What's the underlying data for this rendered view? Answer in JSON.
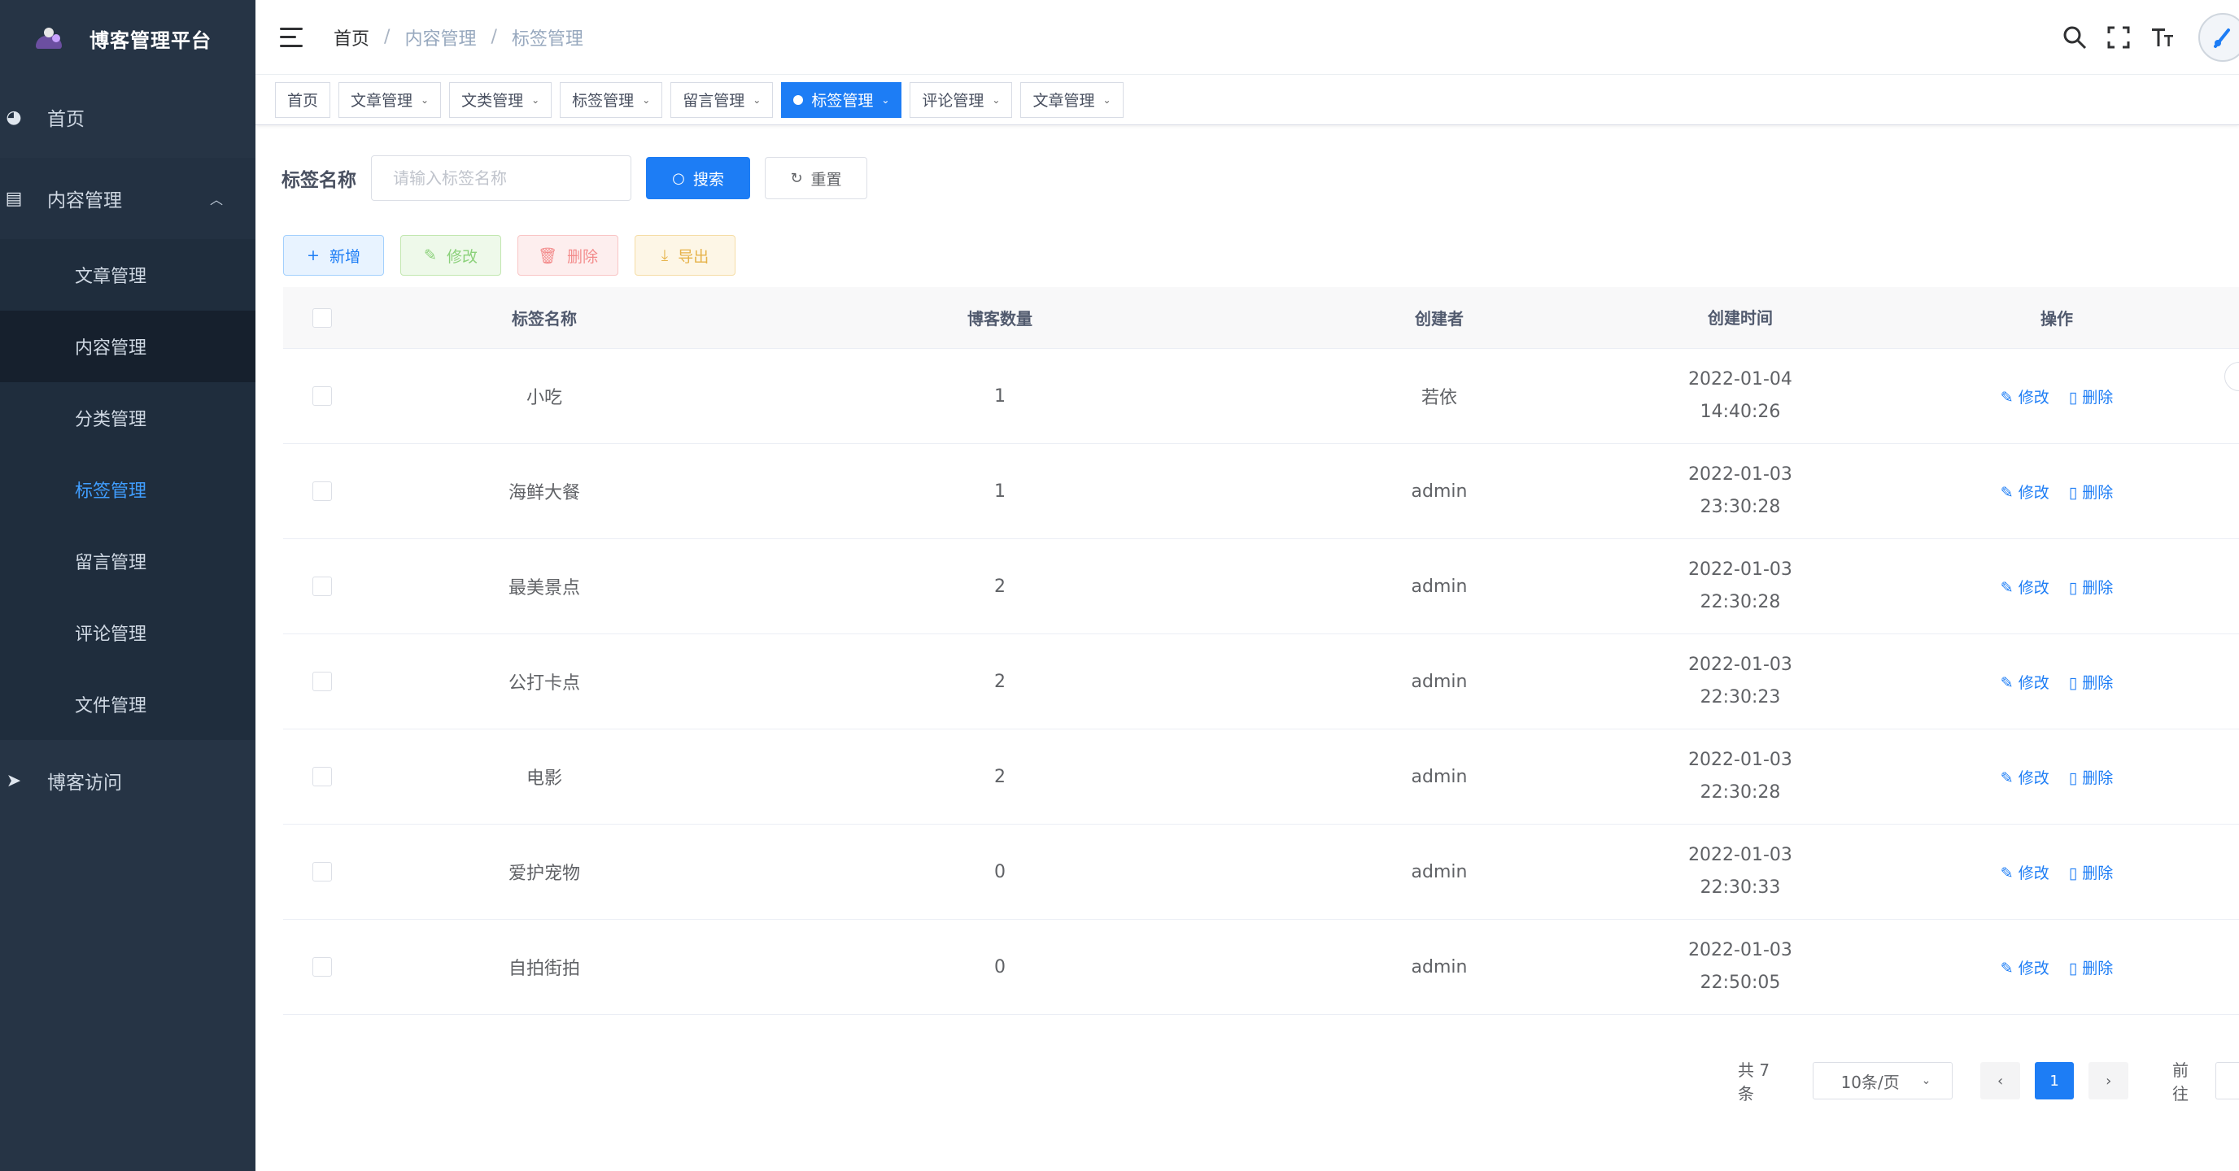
{
  "app": {
    "title": "博客管理平台"
  },
  "sidebar": {
    "home": "首页",
    "content_group": "内容管理",
    "sub_items": [
      "文章管理",
      "内容管理",
      "分类管理",
      "标签管理",
      "留言管理",
      "评论管理",
      "文件管理"
    ],
    "blog_visit": "博客访问"
  },
  "breadcrumb": [
    "首页",
    "内容管理",
    "标签管理"
  ],
  "tags_view": [
    "首页",
    "文章管理",
    "文类管理",
    "标签管理",
    "留言管理",
    "标签管理",
    "评论管理",
    "文章管理"
  ],
  "search": {
    "label": "标签名称",
    "placeholder": "请输入标签名称",
    "search_button": "搜索",
    "reset_button": "重置"
  },
  "toolbar": {
    "add": "新增",
    "edit": "修改",
    "delete": "删除",
    "export": "导出"
  },
  "table": {
    "headers": [
      "标签名称",
      "博客数量",
      "创建者",
      "创建时间",
      "操作"
    ],
    "rows": [
      {
        "name": "小吃",
        "count": "1",
        "creator": "若依",
        "date": "2022-01-04",
        "time": "14:40:26"
      },
      {
        "name": "海鲜大餐",
        "count": "1",
        "creator": "admin",
        "date": "2022-01-03",
        "time": "23:30:28"
      },
      {
        "name": "最美景点",
        "count": "2",
        "creator": "admin",
        "date": "2022-01-03",
        "time": "22:30:28"
      },
      {
        "name": "公打卡点",
        "count": "2",
        "creator": "admin",
        "date": "2022-01-03",
        "time": "22:30:23"
      },
      {
        "name": "电影",
        "count": "2",
        "creator": "admin",
        "date": "2022-01-03",
        "time": "22:30:28"
      },
      {
        "name": "爱护宠物",
        "count": "0",
        "creator": "admin",
        "date": "2022-01-03",
        "time": "22:30:33"
      },
      {
        "name": "自拍街拍",
        "count": "0",
        "creator": "admin",
        "date": "2022-01-03",
        "time": "22:50:05"
      }
    ],
    "edit_label": "修改",
    "delete_label": "删除"
  },
  "pagination": {
    "total": "共 7 条",
    "page_size": "10条/页",
    "prev": "‹",
    "current": "1",
    "next": "›",
    "goto": "前往"
  },
  "colors": {
    "sidebar_bg": "#263445",
    "accent": "#1d7df5"
  }
}
